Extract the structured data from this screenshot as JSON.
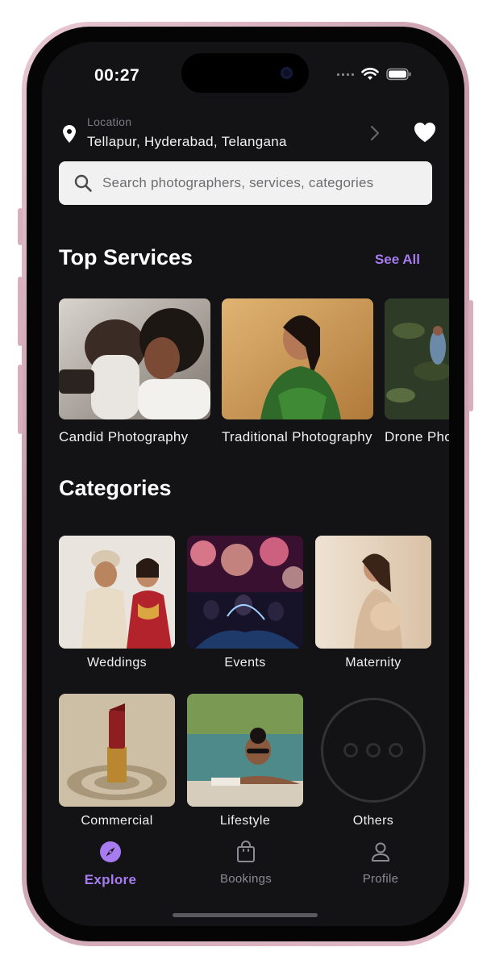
{
  "status": {
    "time": "00:27"
  },
  "location": {
    "label": "Location",
    "value": "Tellapur, Hyderabad, Telangana"
  },
  "search": {
    "placeholder": "Search photographers, services, categories"
  },
  "top_services": {
    "title": "Top Services",
    "see_all": "See All",
    "items": [
      {
        "label": "Candid Photography"
      },
      {
        "label": "Traditional Photography"
      },
      {
        "label": "Drone Photography"
      }
    ]
  },
  "categories": {
    "title": "Categories",
    "items": [
      {
        "label": "Weddings"
      },
      {
        "label": "Events"
      },
      {
        "label": "Maternity"
      },
      {
        "label": "Commercial"
      },
      {
        "label": "Lifestyle"
      },
      {
        "label": "Others"
      }
    ]
  },
  "tabs": [
    {
      "label": "Explore",
      "icon": "compass-icon",
      "active": true
    },
    {
      "label": "Bookings",
      "icon": "shopping-bag-icon",
      "active": false
    },
    {
      "label": "Profile",
      "icon": "person-icon",
      "active": false
    }
  ],
  "colors": {
    "accent": "#a67cf0",
    "background": "#131214",
    "search_bg": "#f1f1f2"
  }
}
